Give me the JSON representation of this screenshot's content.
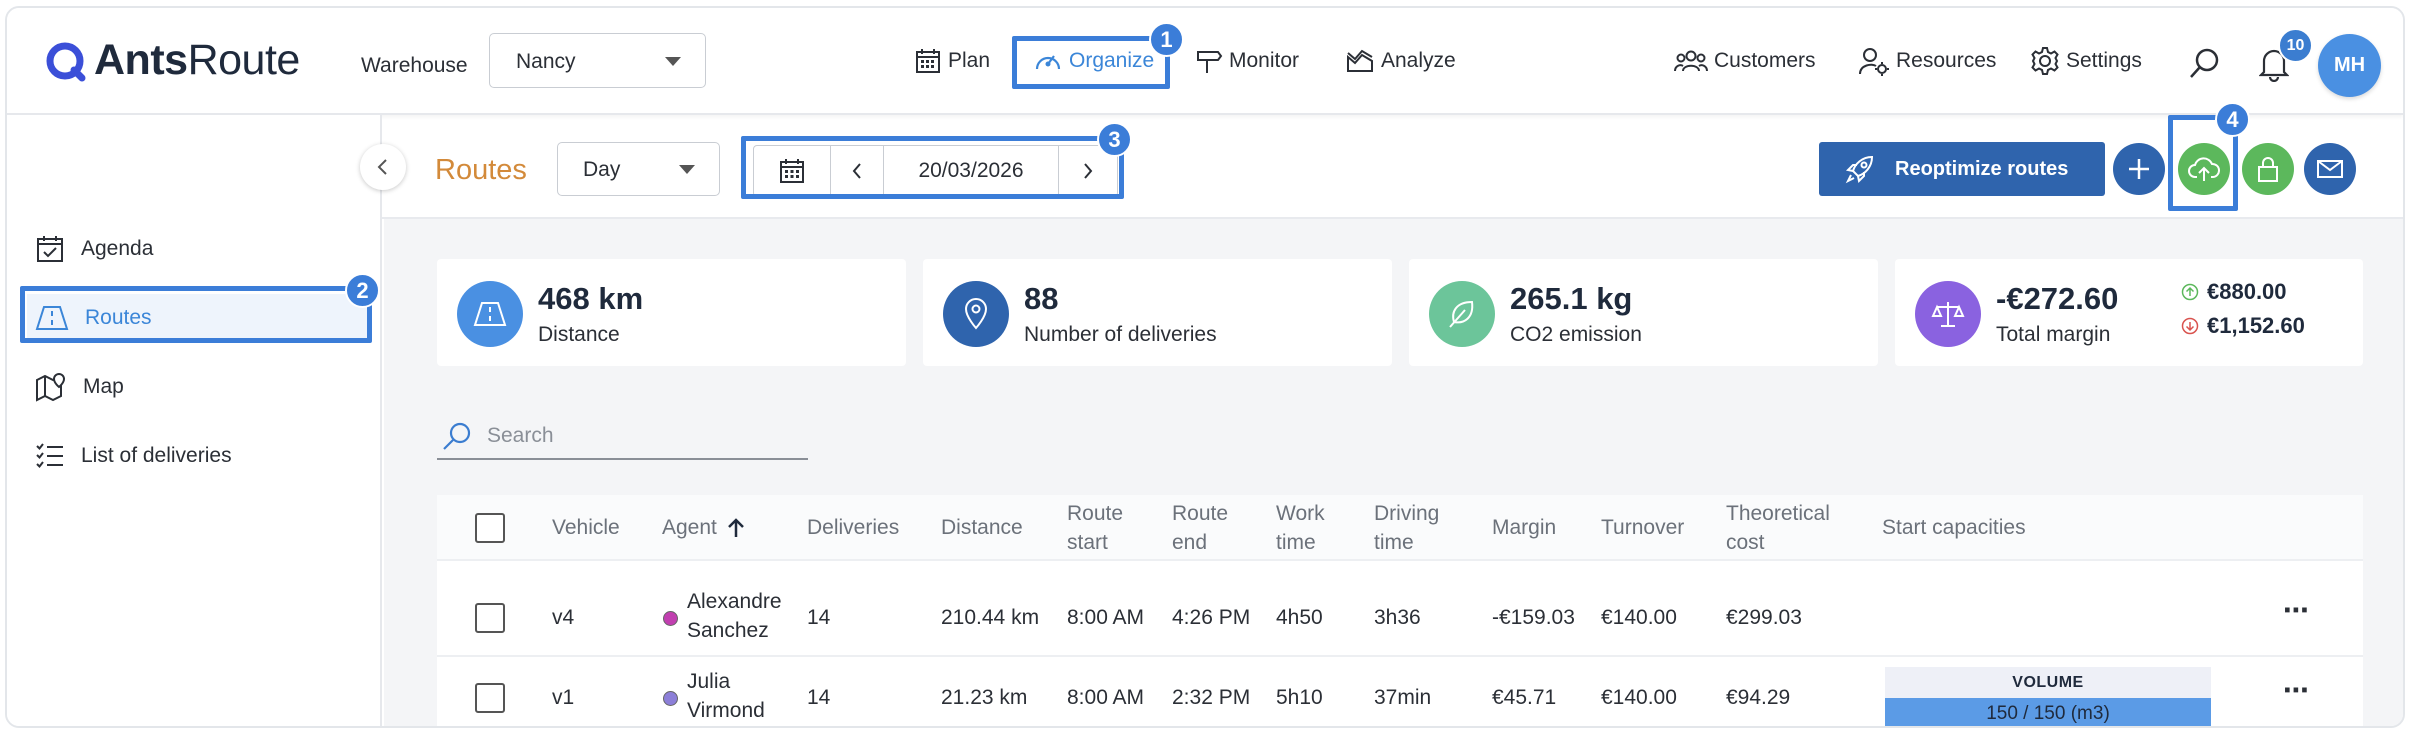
{
  "app": {
    "brand_bold": "Ants",
    "brand_light": "Route"
  },
  "header": {
    "warehouse_label": "Warehouse",
    "warehouse_value": "Nancy",
    "nav": {
      "plan": "Plan",
      "organize": "Organize",
      "monitor": "Monitor",
      "analyze": "Analyze",
      "customers": "Customers",
      "resources": "Resources",
      "settings": "Settings"
    },
    "notifications": "10",
    "avatar": "MH"
  },
  "annotations": [
    "1",
    "2",
    "3",
    "4"
  ],
  "sidebar": {
    "items": [
      {
        "label": "Agenda",
        "icon": "calendar-check-icon"
      },
      {
        "label": "Routes",
        "icon": "road-icon"
      },
      {
        "label": "Map",
        "icon": "map-pin-icon"
      },
      {
        "label": "List of deliveries",
        "icon": "checklist-icon"
      }
    ]
  },
  "toolbar": {
    "title": "Routes",
    "period": "Day",
    "date": "20/03/2026",
    "reoptimize": "Reoptimize routes"
  },
  "kpis": {
    "distance": {
      "value": "468 km",
      "label": "Distance"
    },
    "deliveries": {
      "value": "88",
      "label": "Number of deliveries"
    },
    "co2": {
      "value": "265.1 kg",
      "label": "CO2 emission"
    },
    "margin": {
      "value": "-€272.60",
      "label": "Total margin",
      "up": "€880.00",
      "down": "€1,152.60"
    }
  },
  "search": {
    "placeholder": "Search"
  },
  "table": {
    "columns": {
      "vehicle": "Vehicle",
      "agent": "Agent",
      "deliveries": "Deliveries",
      "distance": "Distance",
      "route_start_1": "Route",
      "route_start_2": "start",
      "route_end_1": "Route",
      "route_end_2": "end",
      "work_1": "Work",
      "work_2": "time",
      "driving_1": "Driving",
      "driving_2": "time",
      "margin": "Margin",
      "turnover": "Turnover",
      "theo_1": "Theoretical",
      "theo_2": "cost",
      "capacities": "Start capacities"
    },
    "rows": [
      {
        "vehicle": "v4",
        "agent_first": "Alexandre",
        "agent_last": "Sanchez",
        "agent_color": "#c13fb0",
        "deliveries": "14",
        "distance": "210.44 km",
        "start": "8:00 AM",
        "end": "4:26 PM",
        "work": "4h50",
        "driving": "3h36",
        "margin": "-€159.03",
        "turnover": "€140.00",
        "cost": "€299.03"
      },
      {
        "vehicle": "v1",
        "agent_first": "Julia",
        "agent_last": "Virmond",
        "agent_color": "#8c7fd8",
        "deliveries": "14",
        "distance": "21.23 km",
        "start": "8:00 AM",
        "end": "2:32 PM",
        "work": "5h10",
        "driving": "37min",
        "margin": "€45.71",
        "turnover": "€140.00",
        "cost": "€94.29",
        "cap_title": "VOLUME",
        "cap_value": "150 / 150 (m3)"
      }
    ]
  },
  "colors": {
    "accent": "#3b86d8",
    "primary": "#2f64ad",
    "success": "#5cb85c",
    "title": "#d38a3a"
  }
}
